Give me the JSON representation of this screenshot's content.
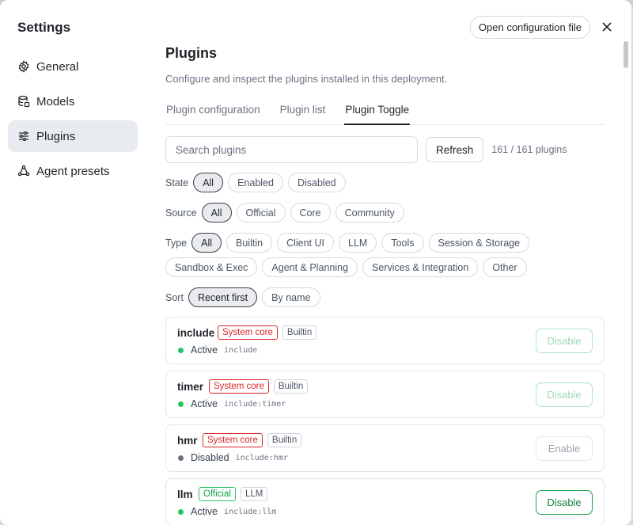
{
  "sidebar": {
    "title": "Settings",
    "items": [
      {
        "label": "General",
        "icon": "gear-icon",
        "active": false
      },
      {
        "label": "Models",
        "icon": "database-icon",
        "active": false
      },
      {
        "label": "Plugins",
        "icon": "sliders-icon",
        "active": true
      },
      {
        "label": "Agent presets",
        "icon": "presets-icon",
        "active": false
      }
    ]
  },
  "header": {
    "open_config_label": "Open configuration file",
    "close_icon": "close-icon"
  },
  "page": {
    "title": "Plugins",
    "description": "Configure and inspect the plugins installed in this deployment."
  },
  "tabs": [
    {
      "label": "Plugin configuration",
      "active": false
    },
    {
      "label": "Plugin list",
      "active": false
    },
    {
      "label": "Plugin Toggle",
      "active": true
    }
  ],
  "search": {
    "placeholder": "Search plugins",
    "value": "",
    "refresh_label": "Refresh",
    "count": "161 / 161 plugins"
  },
  "filters": {
    "state": {
      "label": "State",
      "options": [
        "All",
        "Enabled",
        "Disabled"
      ],
      "selected": "All"
    },
    "source": {
      "label": "Source",
      "options": [
        "All",
        "Official",
        "Core",
        "Community"
      ],
      "selected": "All"
    },
    "type": {
      "label": "Type",
      "options": [
        "All",
        "Builtin",
        "Client UI",
        "LLM",
        "Tools",
        "Session & Storage",
        "Sandbox & Exec",
        "Agent & Planning",
        "Services & Integration",
        "Other"
      ],
      "selected": "All"
    },
    "sort": {
      "label": "Sort",
      "options": [
        "Recent first",
        "By name"
      ],
      "selected": "Recent first"
    }
  },
  "plugins": [
    {
      "name": "include",
      "badges": [
        {
          "text": "System core",
          "style": "red"
        },
        {
          "text": "Builtin",
          "style": "gray"
        }
      ],
      "status": "Active",
      "enabled": true,
      "id": "include",
      "action": "Disable",
      "action_style": "faded"
    },
    {
      "name": "timer",
      "badges": [
        {
          "text": "System core",
          "style": "red"
        },
        {
          "text": "Builtin",
          "style": "gray"
        }
      ],
      "status": "Active",
      "enabled": true,
      "id": "include:timer",
      "action": "Disable",
      "action_style": "faded"
    },
    {
      "name": "hmr",
      "badges": [
        {
          "text": "System core",
          "style": "red"
        },
        {
          "text": "Builtin",
          "style": "gray"
        }
      ],
      "status": "Disabled",
      "enabled": false,
      "id": "include:hmr",
      "action": "Enable",
      "action_style": "neutral"
    },
    {
      "name": "llm",
      "badges": [
        {
          "text": "Official",
          "style": "green"
        },
        {
          "text": "LLM",
          "style": "gray"
        }
      ],
      "status": "Active",
      "enabled": true,
      "id": "include:llm",
      "action": "Disable",
      "action_style": "strong"
    }
  ],
  "colors": {
    "active_dot": "#22c55e",
    "disabled_dot": "#6b7280",
    "system_core": "#dc2626",
    "official": "#16a34a",
    "nav_active_bg": "#e8ebef"
  }
}
